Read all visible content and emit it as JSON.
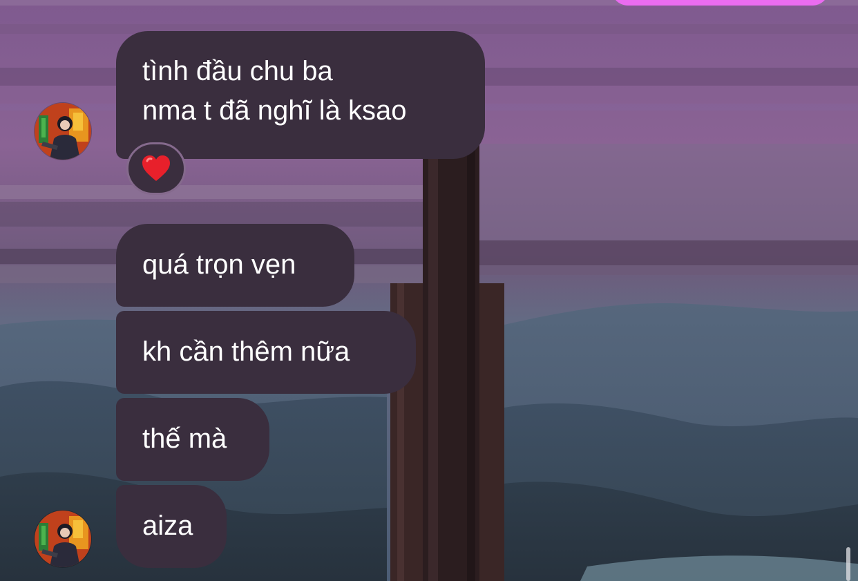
{
  "thread": {
    "messages": [
      {
        "lines": [
          "tình đầu chu ba",
          "nma t đã nghĩ là ksao"
        ],
        "reaction": "heart-icon"
      },
      {
        "lines": [
          "quá trọn vẹn"
        ]
      },
      {
        "lines": [
          "kh cần thêm nữa"
        ]
      },
      {
        "lines": [
          "thế mà"
        ]
      },
      {
        "lines": [
          "aiza"
        ]
      }
    ]
  },
  "colors": {
    "received_bubble": "#3a2e3e",
    "sent_bubble": "#ea6cf0",
    "reaction_border": "#856a8d",
    "text": "#ffffff",
    "heart": "#e8202b"
  }
}
